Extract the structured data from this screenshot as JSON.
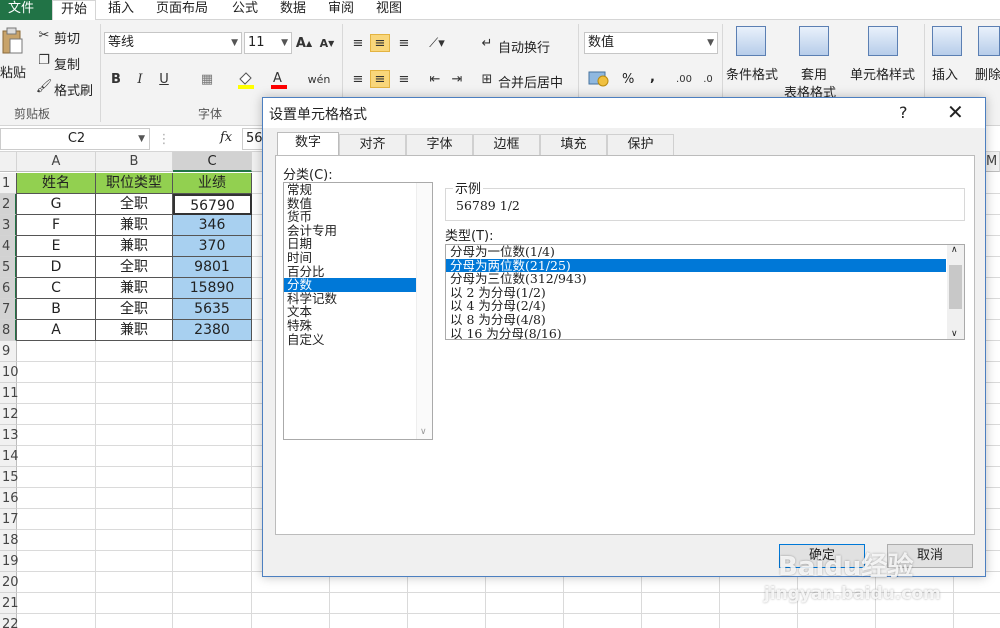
{
  "ribbon": {
    "tabs": [
      "文件",
      "开始",
      "插入",
      "页面布局",
      "公式",
      "数据",
      "审阅",
      "视图"
    ],
    "clipboard": {
      "paste": "粘贴",
      "cut": "剪切",
      "copy": "复制",
      "painter": "格式刷",
      "group": "剪贴板"
    },
    "font": {
      "name": "等线",
      "size": "11",
      "group": "字体",
      "bold": "B",
      "italic": "I",
      "underline": "U"
    },
    "alignment": {
      "wrap": "自动换行",
      "merge": "合并后居中"
    },
    "number": {
      "format": "数值",
      "percent": "%",
      "comma": ","
    },
    "styles": {
      "conditional": "条件格式",
      "table_line1": "套用",
      "table_line2": "表格格式",
      "cell_styles": "单元格样式"
    },
    "cells": {
      "insert": "插入",
      "delete": "删除"
    }
  },
  "formula_bar": {
    "name_box": "C2",
    "fx": "fx",
    "value": "56"
  },
  "sheet": {
    "columns": [
      "A",
      "B",
      "C"
    ],
    "rows": [
      "1",
      "2",
      "3",
      "4",
      "5",
      "6",
      "7",
      "8",
      "9",
      "10",
      "11",
      "12",
      "13",
      "14",
      "15",
      "16",
      "17",
      "18",
      "19",
      "20",
      "21",
      "22"
    ],
    "extra_col": "M",
    "header": [
      "姓名",
      "职位类型",
      "业绩"
    ],
    "data": [
      [
        "G",
        "全职",
        "56790"
      ],
      [
        "F",
        "兼职",
        "346"
      ],
      [
        "E",
        "兼职",
        "370"
      ],
      [
        "D",
        "全职",
        "9801"
      ],
      [
        "C",
        "兼职",
        "15890"
      ],
      [
        "B",
        "全职",
        "5635"
      ],
      [
        "A",
        "兼职",
        "2380"
      ]
    ]
  },
  "dialog": {
    "title": "设置单元格格式",
    "help": "?",
    "close": "✕",
    "tabs": [
      "数字",
      "对齐",
      "字体",
      "边框",
      "填充",
      "保护"
    ],
    "category_label": "分类(C):",
    "categories": [
      "常规",
      "数值",
      "货币",
      "会计专用",
      "日期",
      "时间",
      "百分比",
      "分数",
      "科学记数",
      "文本",
      "特殊",
      "自定义"
    ],
    "selected_category": "分数",
    "sample_label": "示例",
    "sample_value": "56789  1/2",
    "type_label": "类型(T):",
    "types": [
      "分母为一位数(1/4)",
      "分母为两位数(21/25)",
      "分母为三位数(312/943)",
      "以 2 为分母(1/2)",
      "以 4 为分母(2/4)",
      "以 8 为分母(4/8)",
      "以 16 为分母(8/16)"
    ],
    "selected_type": "分母为两位数(21/25)",
    "ok": "确定",
    "cancel": "取消"
  },
  "watermark": {
    "brand": "Baidu经验",
    "url": "jingyan.baidu.com"
  },
  "colors": {
    "excel_green": "#217346",
    "header_fill": "#92d050",
    "selection": "#a8d0f0",
    "list_select": "#0078d7"
  }
}
